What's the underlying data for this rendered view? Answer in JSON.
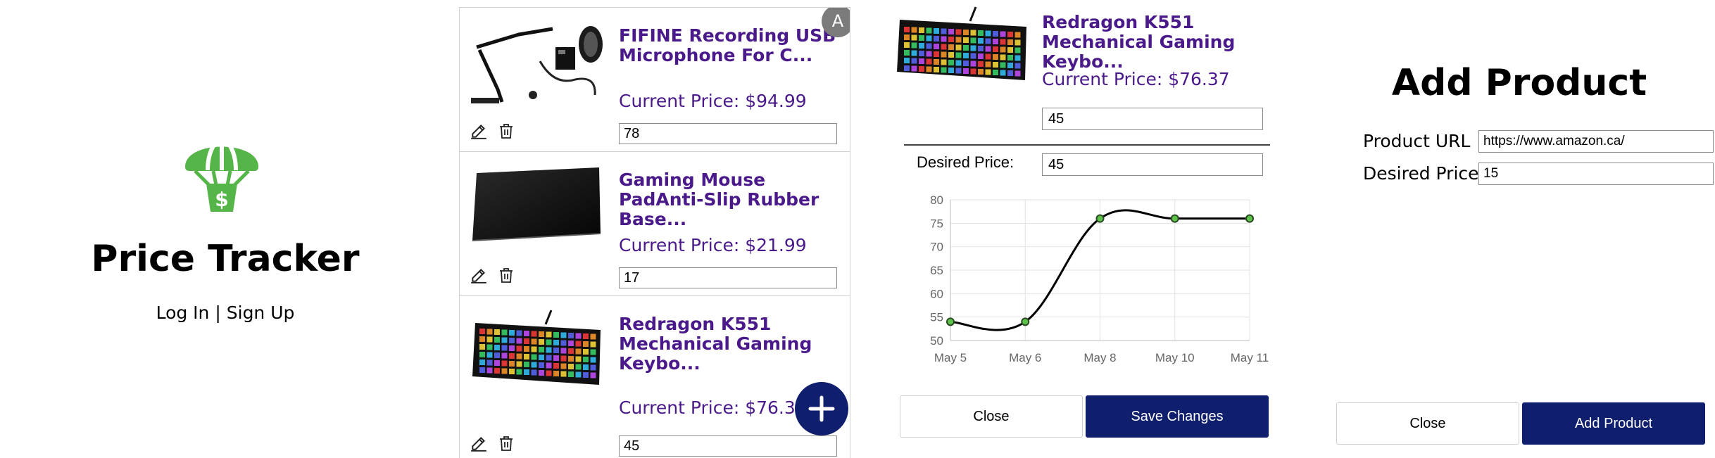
{
  "login": {
    "app_title": "Price Tracker",
    "log_in": "Log In",
    "separator": "|",
    "sign_up": "Sign Up",
    "logo_symbol": "$",
    "logo_icon": "parachute-balloon-dollar-icon",
    "logo_color": "#56b548"
  },
  "list": {
    "avatar_letter": "A",
    "avatar_color": "#7b7b7b",
    "fab_icon": "plus-icon",
    "fab_color": "#0f1f6e",
    "products": [
      {
        "name": "FIFINE Recording USB Microphone For C...",
        "price": "Current Price: $94.99",
        "desired": "78",
        "image": "microphone-arm-image"
      },
      {
        "name": "Gaming Mouse PadAnti-Slip Rubber Base...",
        "price": "Current Price: $21.99",
        "desired": "17",
        "image": "mouse-pad-image"
      },
      {
        "name": "Redragon K551 Mechanical Gaming Keybo...",
        "price": "Current Price: $76.37",
        "desired": "45",
        "image": "rgb-keyboard-image"
      }
    ]
  },
  "edit_modal": {
    "name": "Redragon K551 Mechanical Gaming Keybo...",
    "price": "Current Price: $76.37",
    "top_input_value": "45",
    "desired_label": "Desired Price:",
    "desired_value": "45",
    "close_label": "Close",
    "save_label": "Save Changes",
    "primary_color": "#0f1f6e"
  },
  "chart_data": {
    "type": "line",
    "categories": [
      "May 5",
      "May 6",
      "May 8",
      "May 10",
      "May 11"
    ],
    "series": [
      {
        "values": [
          54,
          54,
          76,
          76,
          76
        ]
      }
    ],
    "ylim": [
      50,
      80
    ],
    "yticks": [
      50,
      55,
      60,
      65,
      70,
      75,
      80
    ],
    "grid": true,
    "title": "",
    "xlabel": "",
    "ylabel": "",
    "line_color": "#000000",
    "point_color": "#5cc24a"
  },
  "add_product": {
    "title": "Add Product",
    "url_label": "Product URL",
    "url_value": "https://www.amazon.ca/",
    "desired_label": "Desired Price",
    "desired_value": "15",
    "close_label": "Close",
    "add_label": "Add Product"
  }
}
